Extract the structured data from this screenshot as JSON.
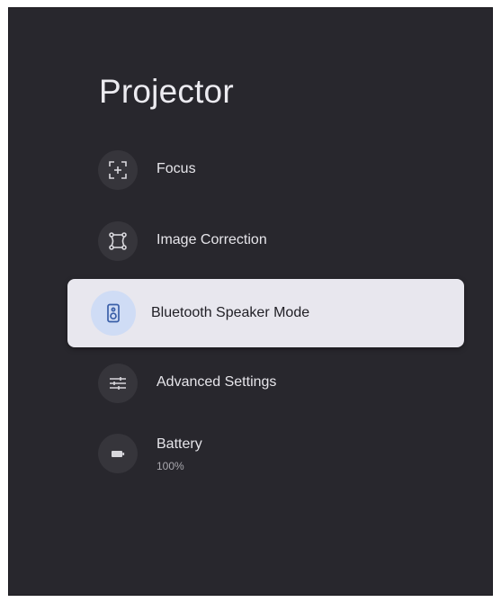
{
  "page": {
    "title": "Projector"
  },
  "menu": {
    "items": [
      {
        "label": "Focus",
        "icon": "focus-icon"
      },
      {
        "label": "Image Correction",
        "icon": "image-correction-icon"
      },
      {
        "label": "Bluetooth Speaker Mode",
        "icon": "speaker-icon",
        "selected": true
      },
      {
        "label": "Advanced Settings",
        "icon": "sliders-icon"
      },
      {
        "label": "Battery",
        "sublabel": "100%",
        "icon": "battery-icon"
      }
    ]
  },
  "colors": {
    "background": "#28272d",
    "selected_background": "#e8e7ee",
    "selected_icon_background": "#cfdcf5",
    "selected_icon_color": "#3a5fa8",
    "icon_background": "#36353b",
    "text": "#e6e5ea"
  }
}
